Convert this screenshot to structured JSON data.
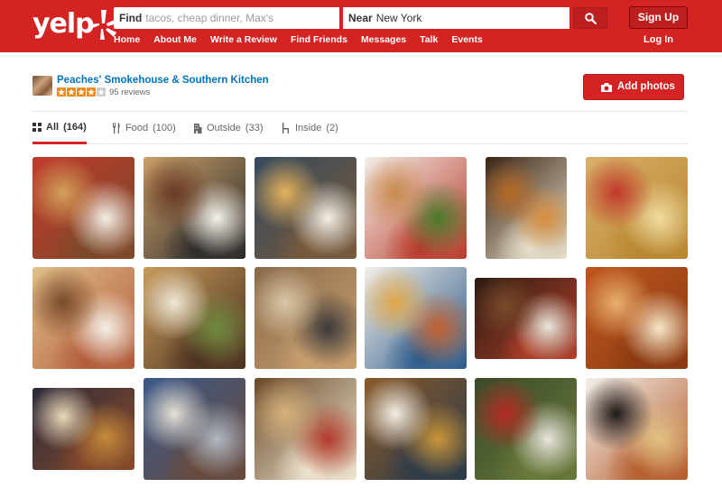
{
  "header": {
    "logo": "yelp",
    "find_label": "Find",
    "find_placeholder": "tacos, cheap dinner, Max's",
    "near_label": "Near",
    "near_value": "New York",
    "signup": "Sign Up",
    "login": "Log In",
    "nav": [
      "Home",
      "About Me",
      "Write a Review",
      "Find Friends",
      "Messages",
      "Talk",
      "Events"
    ]
  },
  "business": {
    "name": "Peaches' Smokehouse & Southern Kitchen",
    "rating": 4,
    "rating_max": 5,
    "reviews": "95 reviews",
    "add_photos": "Add photos"
  },
  "tabs": [
    {
      "label": "All",
      "count": "(164)",
      "icon": "grid-icon",
      "active": true
    },
    {
      "label": "Food",
      "count": "(100)",
      "icon": "fork-knife-icon",
      "active": false
    },
    {
      "label": "Outside",
      "count": "(33)",
      "icon": "building-icon",
      "active": false
    },
    {
      "label": "Inside",
      "count": "(2)",
      "icon": "chair-icon",
      "active": false
    }
  ],
  "colors": {
    "brand_red": "#d32323",
    "link_blue": "#0073bb",
    "star_orange": "#f08a1d",
    "star_empty": "#ccc"
  },
  "photos": [
    {
      "name": "photo-bbq-platter",
      "colors": [
        "#c0392b",
        "#d4a05a",
        "#f2efe6",
        "#7a4a2a"
      ]
    },
    {
      "name": "photo-brisket-sandwich",
      "colors": [
        "#caa06a",
        "#6a3a24",
        "#f3f1ec",
        "#2a2a2a"
      ]
    },
    {
      "name": "photo-chicken-sandwich",
      "colors": [
        "#34495e",
        "#e3b25b",
        "#f5f0e6",
        "#7a5a3a"
      ]
    },
    {
      "name": "photo-chicken-salad",
      "colors": [
        "#f2efe9",
        "#c98b4e",
        "#4a7a2a",
        "#b83a2a"
      ]
    },
    {
      "name": "photo-fried-bites",
      "colors": [
        "#3a2414",
        "#b66a25",
        "#d99040",
        "#e8e0cc"
      ]
    },
    {
      "name": "photo-waffle-fries",
      "colors": [
        "#d9b06a",
        "#c0392b",
        "#f0dca0",
        "#b8862f"
      ]
    },
    {
      "name": "photo-wrap",
      "colors": [
        "#e0c08a",
        "#7a4a2a",
        "#f4f0e8",
        "#b25a3a"
      ]
    },
    {
      "name": "photo-burger-sauce",
      "colors": [
        "#c79a5a",
        "#eee8d6",
        "#6e8a3e",
        "#4a3020"
      ]
    },
    {
      "name": "photo-sliders-collage",
      "colors": [
        "#8a6a4a",
        "#d8c6a6",
        "#3a3a3a",
        "#c9a070"
      ]
    },
    {
      "name": "photo-grilled-cheese",
      "colors": [
        "#f3efe8",
        "#e0a84a",
        "#c2612f",
        "#2b5a8a"
      ]
    },
    {
      "name": "photo-pulled-pork-sandwich",
      "colors": [
        "#2a1a12",
        "#7a4a2a",
        "#e9e6dc",
        "#b2402a"
      ]
    },
    {
      "name": "photo-baked-beans",
      "colors": [
        "#c0571e",
        "#e8b070",
        "#f5e6c8",
        "#8a3a12"
      ]
    },
    {
      "name": "photo-loaded-fries",
      "colors": [
        "#2b2b3a",
        "#e8d9b8",
        "#c78a3a",
        "#8a4a2a"
      ]
    },
    {
      "name": "photo-restaurant-collage",
      "colors": [
        "#3a5a8a",
        "#e6e0d6",
        "#b0b8c0",
        "#6a4a3a"
      ]
    },
    {
      "name": "photo-charcuterie",
      "colors": [
        "#6a4a2a",
        "#d8b07a",
        "#b23a2a",
        "#f0e6d2"
      ]
    },
    {
      "name": "photo-roast-chicken",
      "colors": [
        "#8a5a2a",
        "#f4efe4",
        "#c9953a",
        "#2a3a4a"
      ]
    },
    {
      "name": "photo-kale-salad",
      "colors": [
        "#3a4a2a",
        "#b52a22",
        "#e8e4dc",
        "#6a7a3a"
      ]
    },
    {
      "name": "photo-black-beans",
      "colors": [
        "#f3f0eb",
        "#1e1a18",
        "#e0c080",
        "#b45a2a"
      ]
    }
  ]
}
